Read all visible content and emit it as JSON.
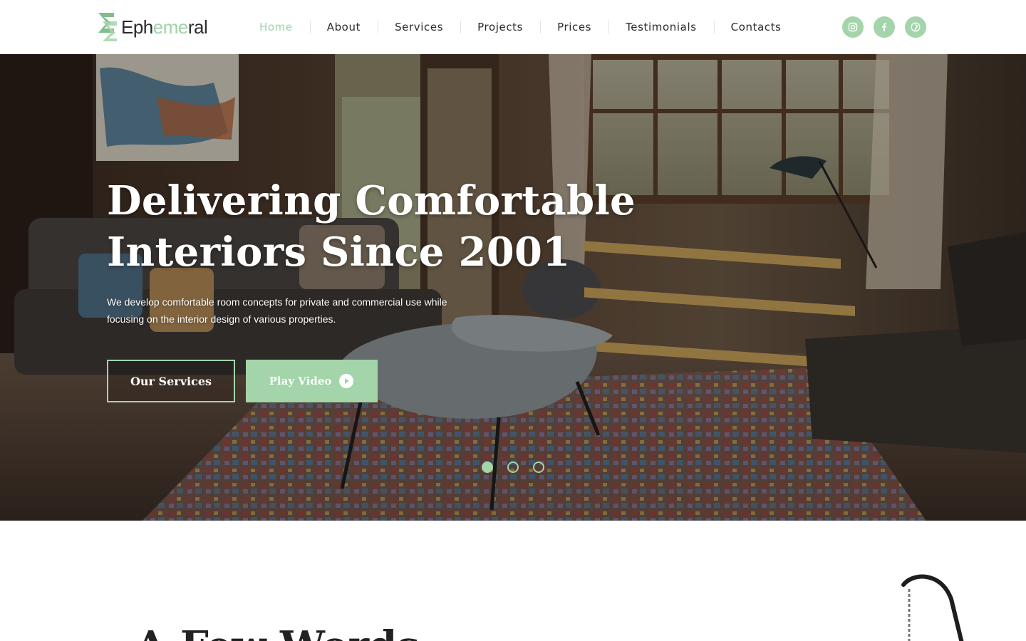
{
  "brand": {
    "name_start": "Eph",
    "name_accent": "eme",
    "name_end": "ral",
    "accent_color": "#a3d4aa"
  },
  "nav": {
    "items": [
      {
        "label": "Home",
        "active": true
      },
      {
        "label": "About"
      },
      {
        "label": "Services"
      },
      {
        "label": "Projects"
      },
      {
        "label": "Prices"
      },
      {
        "label": "Testimonials"
      },
      {
        "label": "Contacts"
      }
    ]
  },
  "socials": [
    {
      "icon": "instagram-icon"
    },
    {
      "icon": "facebook-icon"
    },
    {
      "icon": "pinterest-icon"
    }
  ],
  "hero": {
    "title_line1": "Delivering Comfortable",
    "title_line2": "Interiors Since 2001",
    "text": "We develop comfortable room concepts for private and commercial use while focusing on the interior design of various properties.",
    "btn_services": "Our Services",
    "btn_video": "Play Video",
    "slides_total": 3,
    "slide_active": 1
  },
  "section": {
    "heading_peek": "A Few Words"
  }
}
